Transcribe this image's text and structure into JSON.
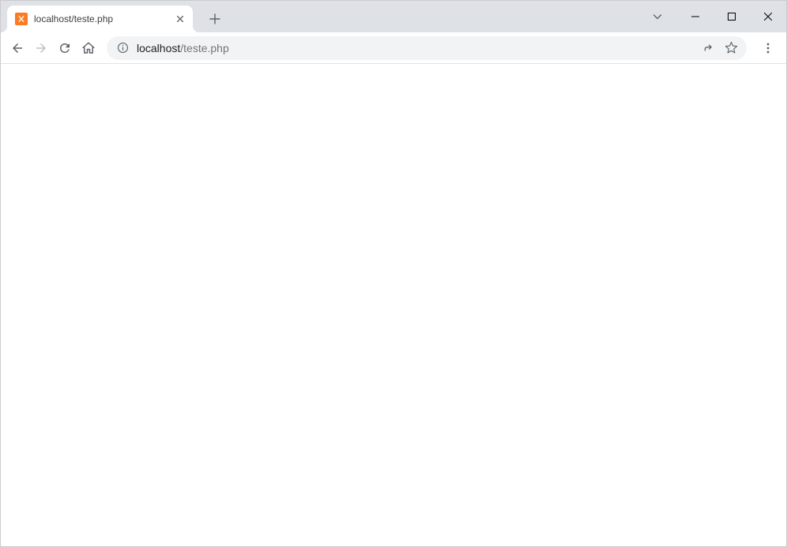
{
  "tab": {
    "title": "localhost/teste.php"
  },
  "address": {
    "host": "localhost",
    "path": "/teste.php"
  }
}
